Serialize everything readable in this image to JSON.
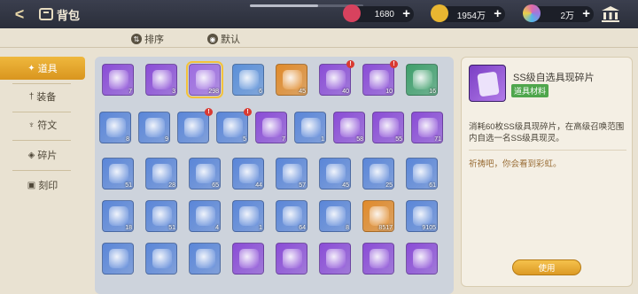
{
  "header": {
    "title": "背包",
    "back_label": "<",
    "resources": [
      {
        "name": "ticket",
        "value": "1680",
        "color": "#d8425e"
      },
      {
        "name": "gold",
        "value": "1954万",
        "color": "#e8b631"
      },
      {
        "name": "crystal",
        "value": "2万",
        "color": "#9b7ae0"
      }
    ],
    "plus": "+"
  },
  "sort": {
    "order_label": "排序",
    "order_icon": "⇅",
    "default_label": "默认",
    "default_icon": "◉"
  },
  "sidebar": {
    "tabs": [
      {
        "label": "道具",
        "icon": "✦",
        "active": true
      },
      {
        "label": "装备",
        "icon": "†",
        "active": false
      },
      {
        "label": "符文",
        "icon": "♆",
        "active": false
      },
      {
        "label": "碎片",
        "icon": "◈",
        "active": false
      },
      {
        "label": "刻印",
        "icon": "▣",
        "active": false
      }
    ]
  },
  "grid": {
    "rows": [
      [
        {
          "c": "#8a4cd6",
          "q": "7"
        },
        {
          "c": "#8a4cd6",
          "q": "3"
        },
        {
          "c": "#9d6be0",
          "q": "298",
          "sel": true
        },
        {
          "c": "#5a8fd8",
          "q": "6"
        },
        {
          "c": "#e08a2a",
          "q": "45"
        },
        {
          "c": "#8a4cd6",
          "q": "40",
          "badge": true
        },
        {
          "c": "#8a4cd6",
          "q": "10",
          "badge": true
        },
        {
          "c": "#3f9f6b",
          "q": "16"
        }
      ],
      [
        {
          "c": "#5a86d8",
          "q": "8"
        },
        {
          "c": "#5a86d8",
          "q": "9"
        },
        {
          "c": "#5a86d8",
          "q": "",
          "badge": true
        },
        {
          "c": "#5a86d8",
          "q": "5",
          "badge": true
        },
        {
          "c": "#8a4cd6",
          "q": "7"
        },
        {
          "c": "#5a86d8",
          "q": "1"
        },
        {
          "c": "#8a4cd6",
          "q": "58"
        },
        {
          "c": "#8a4cd6",
          "q": "55"
        },
        {
          "c": "#8a4cd6",
          "q": "71"
        }
      ],
      [
        {
          "c": "#5a86d8",
          "q": "51"
        },
        {
          "c": "#5a86d8",
          "q": "28"
        },
        {
          "c": "#5a86d8",
          "q": "65"
        },
        {
          "c": "#5a86d8",
          "q": "44"
        },
        {
          "c": "#5a86d8",
          "q": "57"
        },
        {
          "c": "#5a86d8",
          "q": "45"
        },
        {
          "c": "#5a86d8",
          "q": "25"
        },
        {
          "c": "#5a86d8",
          "q": "61"
        }
      ],
      [
        {
          "c": "#5a86d8",
          "q": "18"
        },
        {
          "c": "#5a86d8",
          "q": "51"
        },
        {
          "c": "#5a86d8",
          "q": "4"
        },
        {
          "c": "#5a86d8",
          "q": "1"
        },
        {
          "c": "#5a86d8",
          "q": "64"
        },
        {
          "c": "#5a86d8",
          "q": "8"
        },
        {
          "c": "#e08a2a",
          "q": "8517"
        },
        {
          "c": "#5a86d8",
          "q": "9105"
        }
      ],
      [
        {
          "c": "#5a86d8",
          "q": ""
        },
        {
          "c": "#5a86d8",
          "q": ""
        },
        {
          "c": "#5a86d8",
          "q": ""
        },
        {
          "c": "#8a4cd6",
          "q": ""
        },
        {
          "c": "#8a4cd6",
          "q": ""
        },
        {
          "c": "#8a4cd6",
          "q": ""
        },
        {
          "c": "#8a4cd6",
          "q": ""
        },
        {
          "c": "#8a4cd6",
          "q": ""
        }
      ]
    ]
  },
  "detail": {
    "name": "SS级自选具现碎片",
    "tag": "道具材料",
    "description": "消耗60枚SS级具现碎片，在高级召唤范围内自选一名SS级具现灵。",
    "flavor": "祈祷吧，你会看到彩虹。",
    "use_label": "使用"
  }
}
